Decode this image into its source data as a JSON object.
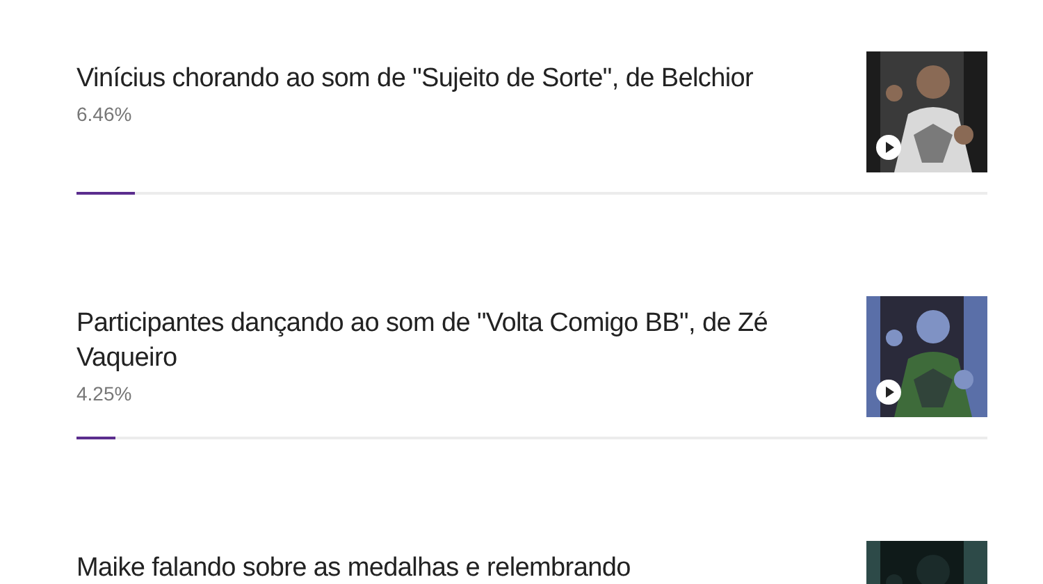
{
  "items": [
    {
      "title": "Vinícius chorando ao som de \"Sujeito de Sorte\", de Belchior",
      "percent": "6.46%",
      "level": 0.0646,
      "thumbnail": {
        "kind": "picture",
        "video": true
      }
    },
    {
      "title": "Participantes dançando ao som de \"Volta Comigo BB\", de Zé Vaqueiro",
      "percent": "4.25%",
      "level": 0.0425,
      "thumbnail": {
        "kind": "picture",
        "video": true
      }
    },
    {
      "title": "Maike falando sobre as medalhas e relembrando",
      "thumbnail": {
        "kind": "picture",
        "video": false
      }
    }
  ]
}
